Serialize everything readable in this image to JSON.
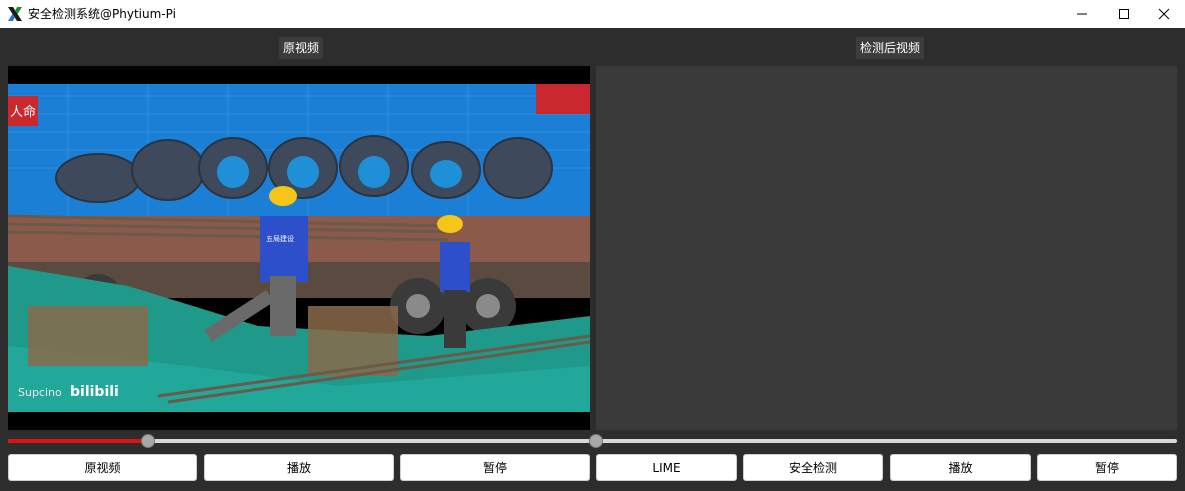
{
  "window": {
    "title": "安全检测系统@Phytium-Pi"
  },
  "panels": {
    "left_label": "原视频",
    "right_label": "检测后视频"
  },
  "video": {
    "watermark_left": "Supcino",
    "watermark_right": "bilibili",
    "vest_text": "五局建设",
    "sign_text": "人命"
  },
  "sliders": {
    "left_progress": 0.24,
    "right_progress": 0.0
  },
  "buttons": {
    "original_video": "原视频",
    "play_left": "播放",
    "pause_left": "暂停",
    "lime": "LIME",
    "safety_detection": "安全检测",
    "play_right": "播放",
    "pause_right": "暂停"
  },
  "colors": {
    "progress_fill": "#e01010",
    "background": "#2d2d2d"
  }
}
